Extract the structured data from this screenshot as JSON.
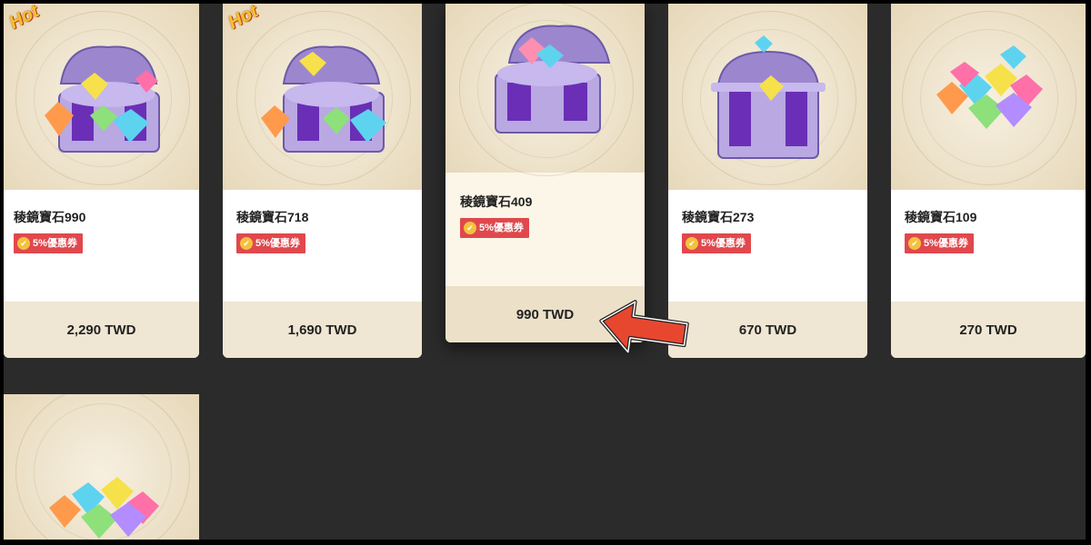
{
  "products": [
    {
      "name": "稜鏡寶石990",
      "coupon": "5%優惠券",
      "price": "2,290 TWD",
      "hot": "Hot",
      "icon": "treasure-chest-gems"
    },
    {
      "name": "稜鏡寶石718",
      "coupon": "5%優惠券",
      "price": "1,690 TWD",
      "hot": "Hot",
      "icon": "treasure-chest-gems"
    },
    {
      "name": "稜鏡寶石409",
      "coupon": "5%優惠券",
      "price": "990 TWD",
      "icon": "treasure-chest-gems"
    },
    {
      "name": "稜鏡寶石273",
      "coupon": "5%優惠券",
      "price": "670 TWD",
      "icon": "treasure-chest-closed"
    },
    {
      "name": "稜鏡寶石109",
      "coupon": "5%優惠券",
      "price": "270 TWD",
      "icon": "gem-pile"
    },
    {
      "icon": "gem-pile"
    }
  ],
  "colors": {
    "coupon": "#e0484d",
    "arrow": "#e8472f",
    "background": "#2b2b2b"
  }
}
